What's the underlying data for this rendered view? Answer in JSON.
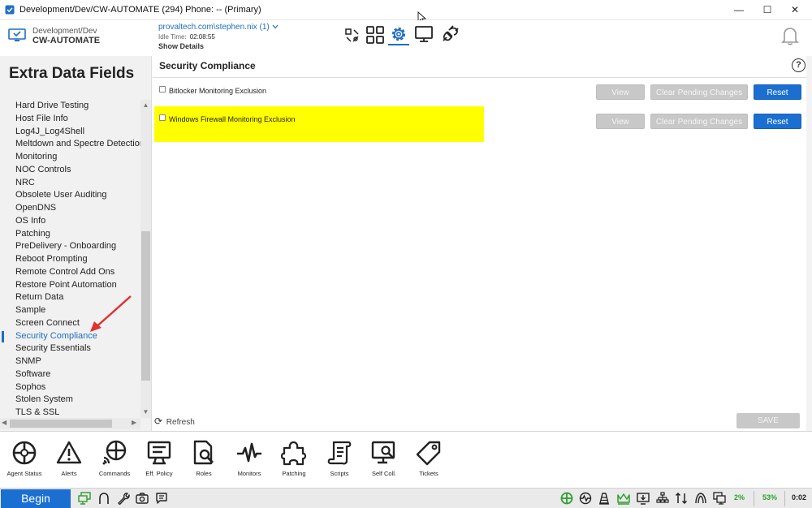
{
  "window": {
    "title": "Development/Dev/CW-AUTOMATE (294) Phone: -- (Primary)",
    "min_glyph": "—",
    "max_glyph": "☐",
    "close_glyph": "✕"
  },
  "header": {
    "site_path": "Development/Dev",
    "site_name": "CW-AUTOMATE",
    "user": "provaltech.com\\stephen.nix (1)",
    "idle_label": "Idle Time:",
    "idle_value": "02:08:55",
    "show_details": "Show Details",
    "icons": [
      "remote-tools-icon",
      "grid-icon",
      "gear-icon",
      "monitor-icon",
      "plug-icon"
    ],
    "accent": "#1f6fc1"
  },
  "sidebar": {
    "title": "Extra Data Fields",
    "items": [
      "Hard Drive Testing",
      "Host File Info",
      "Log4J_Log4Shell",
      "Meltdown and Spectre Detection",
      "Monitoring",
      "NOC Controls",
      "NRC",
      "Obsolete User Auditing",
      "OpenDNS",
      "OS Info",
      "Patching",
      "PreDelivery - Onboarding",
      "Reboot Prompting",
      "Remote Control Add Ons",
      "Restore Point Automation",
      "Return Data",
      "Sample",
      "Screen Connect",
      "Security Compliance",
      "Security Essentials",
      "SNMP",
      "Software",
      "Sophos",
      "Stolen System",
      "TLS & SSL"
    ],
    "selected": "Security Compliance"
  },
  "main": {
    "title": "Security Compliance",
    "help": "?",
    "rows": [
      {
        "label": "Bitlocker Monitoring Exclusion",
        "checked": false,
        "highlighted": false
      },
      {
        "label": "Windows Firewall Monitoring Exclusion",
        "checked": false,
        "highlighted": true
      }
    ],
    "buttons": {
      "view": "View",
      "clear": "Clear Pending Changes",
      "reset": "Reset"
    },
    "refresh": "Refresh",
    "save": "SAVE",
    "highlight_color": "#ffff00"
  },
  "toolbar": {
    "items": [
      {
        "label": "Agent Status",
        "icon": "agent-status-icon"
      },
      {
        "label": "Alerts",
        "icon": "alert-icon"
      },
      {
        "label": "Commands",
        "icon": "commands-icon"
      },
      {
        "label": "Eff. Policy",
        "icon": "policy-icon"
      },
      {
        "label": "Roles",
        "icon": "roles-icon"
      },
      {
        "label": "Monitors",
        "icon": "monitors-icon"
      },
      {
        "label": "Patching",
        "icon": "patching-icon"
      },
      {
        "label": "Scripts",
        "icon": "scripts-icon"
      },
      {
        "label": "Self Coll.",
        "icon": "self-collect-icon"
      },
      {
        "label": "Tickets",
        "icon": "ticket-icon"
      }
    ]
  },
  "taskbar": {
    "begin": "Begin",
    "cpu": "2%",
    "mem": "53%",
    "time": "0:02",
    "good_color": "#2e9e2e"
  }
}
